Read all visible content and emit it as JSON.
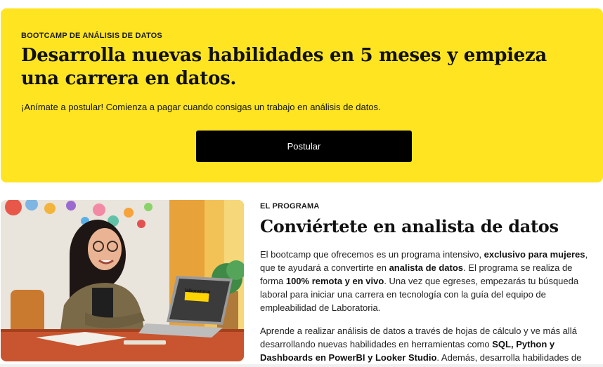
{
  "hero": {
    "eyebrow": "BOOTCAMP DE ANÁLISIS DE DATOS",
    "title": "Desarrolla nuevas habilidades en 5 meses y empieza una carrera en datos.",
    "subtitle": "¡Anímate a postular! Comienza a pagar cuando consigas un trabajo en análisis de datos.",
    "cta_label": "Postular",
    "background_color": "#ffe521"
  },
  "program": {
    "eyebrow": "EL PROGRAMA",
    "title": "Conviértete en analista de datos",
    "p1": {
      "t1": "El bootcamp que ofrecemos es un programa intensivo, ",
      "b1": "exclusivo para mujeres",
      "t2": ", que te ayudará a convertirte en ",
      "b2": "analista de datos",
      "t3": ". El programa se realiza de forma ",
      "b3": "100% remota y en vivo",
      "t4": ". Una vez que egreses, empezarás tu búsqueda laboral para iniciar una carrera en tecnología con la guía del equipo de empleabilidad de Laboratoria."
    },
    "p2": {
      "t1": "Aprende a realizar análisis de datos a través de hojas de cálculo y ve más allá desarrollando nuevas habilidades en herramientas como ",
      "b1": "SQL, Python y Dashboards en PowerBI y Looker Studio",
      "t2": ". Además, desarrolla habilidades de"
    },
    "laptop_sticker": "laboratoria"
  }
}
